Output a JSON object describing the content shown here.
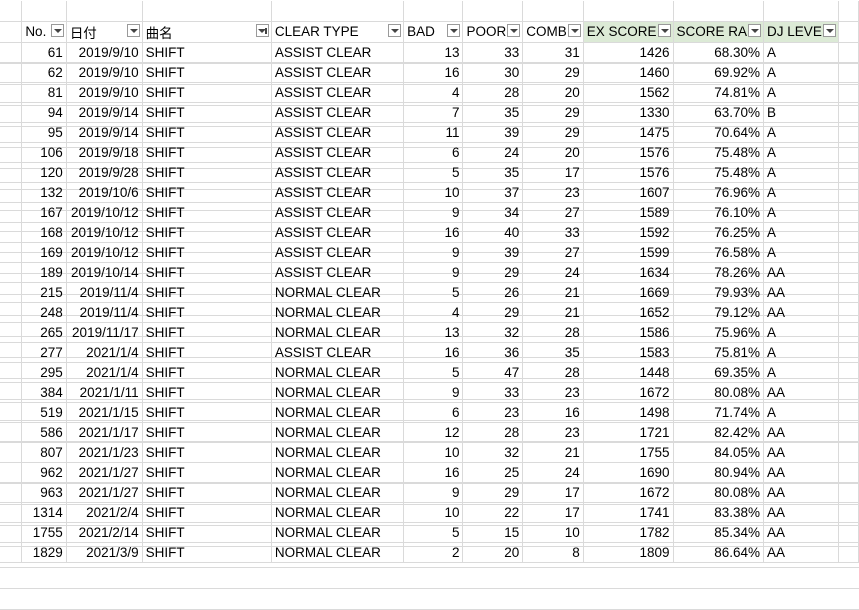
{
  "headers": [
    {
      "label": "No.",
      "filter": "normal"
    },
    {
      "label": "日付",
      "filter": "normal"
    },
    {
      "label": "曲名",
      "filter": "active"
    },
    {
      "label": "CLEAR TYPE",
      "filter": "normal"
    },
    {
      "label": "BAD",
      "filter": "normal"
    },
    {
      "label": "POOR",
      "filter": "normal"
    },
    {
      "label": "COMB",
      "filter": "normal"
    },
    {
      "label": "EX SCORE",
      "filter": "normal"
    },
    {
      "label": "SCORE RA",
      "filter": "normal"
    },
    {
      "label": "DJ LEVE",
      "filter": "normal"
    }
  ],
  "highlight_color": "#dcead6",
  "rows": [
    [
      "61",
      "2019/9/10",
      "SHIFT",
      "ASSIST CLEAR",
      "13",
      "33",
      "31",
      "1426",
      "68.30%",
      "A"
    ],
    [
      "62",
      "2019/9/10",
      "SHIFT",
      "ASSIST CLEAR",
      "16",
      "30",
      "29",
      "1460",
      "69.92%",
      "A"
    ],
    [
      "81",
      "2019/9/10",
      "SHIFT",
      "ASSIST CLEAR",
      "4",
      "28",
      "20",
      "1562",
      "74.81%",
      "A"
    ],
    [
      "94",
      "2019/9/14",
      "SHIFT",
      "ASSIST CLEAR",
      "7",
      "35",
      "29",
      "1330",
      "63.70%",
      "B"
    ],
    [
      "95",
      "2019/9/14",
      "SHIFT",
      "ASSIST CLEAR",
      "11",
      "39",
      "29",
      "1475",
      "70.64%",
      "A"
    ],
    [
      "106",
      "2019/9/18",
      "SHIFT",
      "ASSIST CLEAR",
      "6",
      "24",
      "20",
      "1576",
      "75.48%",
      "A"
    ],
    [
      "120",
      "2019/9/28",
      "SHIFT",
      "ASSIST CLEAR",
      "5",
      "35",
      "17",
      "1576",
      "75.48%",
      "A"
    ],
    [
      "132",
      "2019/10/6",
      "SHIFT",
      "ASSIST CLEAR",
      "10",
      "37",
      "23",
      "1607",
      "76.96%",
      "A"
    ],
    [
      "167",
      "2019/10/12",
      "SHIFT",
      "ASSIST CLEAR",
      "9",
      "34",
      "27",
      "1589",
      "76.10%",
      "A"
    ],
    [
      "168",
      "2019/10/12",
      "SHIFT",
      "ASSIST CLEAR",
      "16",
      "40",
      "33",
      "1592",
      "76.25%",
      "A"
    ],
    [
      "169",
      "2019/10/12",
      "SHIFT",
      "ASSIST CLEAR",
      "9",
      "39",
      "27",
      "1599",
      "76.58%",
      "A"
    ],
    [
      "189",
      "2019/10/14",
      "SHIFT",
      "ASSIST CLEAR",
      "9",
      "29",
      "24",
      "1634",
      "78.26%",
      "AA"
    ],
    [
      "215",
      "2019/11/4",
      "SHIFT",
      "NORMAL CLEAR",
      "5",
      "26",
      "21",
      "1669",
      "79.93%",
      "AA"
    ],
    [
      "248",
      "2019/11/4",
      "SHIFT",
      "NORMAL CLEAR",
      "4",
      "29",
      "21",
      "1652",
      "79.12%",
      "AA"
    ],
    [
      "265",
      "2019/11/17",
      "SHIFT",
      "NORMAL CLEAR",
      "13",
      "32",
      "28",
      "1586",
      "75.96%",
      "A"
    ],
    [
      "277",
      "2021/1/4",
      "SHIFT",
      "ASSIST CLEAR",
      "16",
      "36",
      "35",
      "1583",
      "75.81%",
      "A"
    ],
    [
      "295",
      "2021/1/4",
      "SHIFT",
      "NORMAL CLEAR",
      "5",
      "47",
      "28",
      "1448",
      "69.35%",
      "A"
    ],
    [
      "384",
      "2021/1/11",
      "SHIFT",
      "NORMAL CLEAR",
      "9",
      "33",
      "23",
      "1672",
      "80.08%",
      "AA"
    ],
    [
      "519",
      "2021/1/15",
      "SHIFT",
      "NORMAL CLEAR",
      "6",
      "23",
      "16",
      "1498",
      "71.74%",
      "A"
    ],
    [
      "586",
      "2021/1/17",
      "SHIFT",
      "NORMAL CLEAR",
      "12",
      "28",
      "23",
      "1721",
      "82.42%",
      "AA"
    ],
    [
      "807",
      "2021/1/23",
      "SHIFT",
      "NORMAL CLEAR",
      "10",
      "32",
      "21",
      "1755",
      "84.05%",
      "AA"
    ],
    [
      "962",
      "2021/1/27",
      "SHIFT",
      "NORMAL CLEAR",
      "16",
      "25",
      "24",
      "1690",
      "80.94%",
      "AA"
    ],
    [
      "963",
      "2021/1/27",
      "SHIFT",
      "NORMAL CLEAR",
      "9",
      "29",
      "17",
      "1672",
      "80.08%",
      "AA"
    ],
    [
      "1314",
      "2021/2/4",
      "SHIFT",
      "NORMAL CLEAR",
      "10",
      "22",
      "17",
      "1741",
      "83.38%",
      "AA"
    ],
    [
      "1755",
      "2021/2/14",
      "SHIFT",
      "NORMAL CLEAR",
      "5",
      "15",
      "10",
      "1782",
      "85.34%",
      "AA"
    ],
    [
      "1829",
      "2021/3/9",
      "SHIFT",
      "NORMAL CLEAR",
      "2",
      "20",
      "8",
      "1809",
      "86.64%",
      "AA"
    ]
  ]
}
